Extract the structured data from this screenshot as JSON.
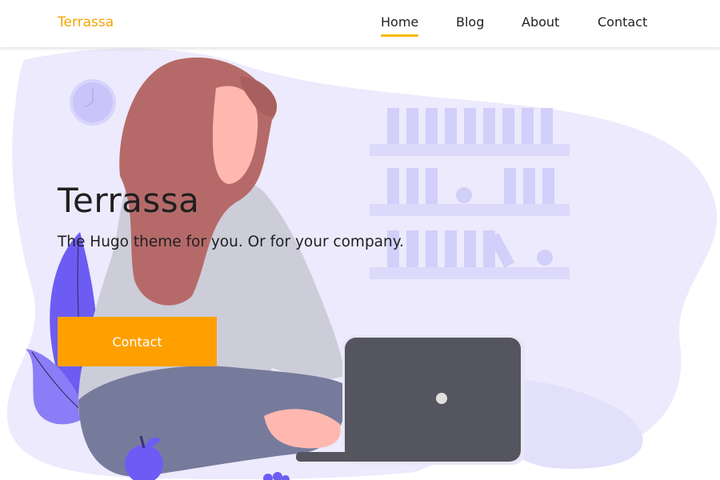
{
  "header": {
    "brand": "Terrassa",
    "nav": [
      {
        "label": "Home",
        "active": true
      },
      {
        "label": "Blog",
        "active": false
      },
      {
        "label": "About",
        "active": false
      },
      {
        "label": "Contact",
        "active": false
      }
    ]
  },
  "hero": {
    "title": "Terrassa",
    "subtitle": "The Hugo theme for you. Or for your company.",
    "cta_label": "Contact"
  },
  "colors": {
    "accent": "#ffa000",
    "brand": "#f5a300",
    "nav_underline": "#f5b800",
    "blob": "#eceafc",
    "hair": "#b56a69",
    "laptop": "#55555f",
    "plant": "#7b6cf6"
  }
}
